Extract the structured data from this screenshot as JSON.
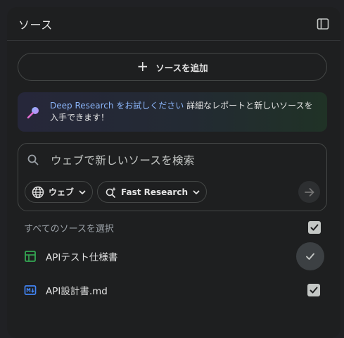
{
  "header": {
    "title": "ソース",
    "panel_toggle_icon": "side-panel-icon"
  },
  "add_source": {
    "label": "ソースを追加",
    "icon": "plus-icon"
  },
  "promo": {
    "link_text": "Deep Research をお試しください",
    "body_text": " 詳細なレポートと新しいソースを入手できます！",
    "icon": "magnifier-sparkle-icon"
  },
  "search": {
    "placeholder": "ウェブで新しいソースを検索",
    "source_chip": {
      "label": "ウェブ",
      "icon": "globe-icon"
    },
    "mode_chip": {
      "label": "Fast Research",
      "icon": "sparkle-search-icon"
    },
    "submit_icon": "arrow-right-icon"
  },
  "select_all": {
    "label": "すべてのソースを選択",
    "checked": true
  },
  "sources": [
    {
      "name": "APIテスト仕様書",
      "icon": "spreadsheet-icon",
      "icon_color": "#34a853",
      "checked": true
    },
    {
      "name": "API設計書.md",
      "icon": "markdown-icon",
      "icon_color": "#4285f4",
      "checked": true
    }
  ],
  "colors": {
    "accent_link": "#8ab4f8",
    "panel_bg": "#1e1f20",
    "border": "#444746"
  }
}
